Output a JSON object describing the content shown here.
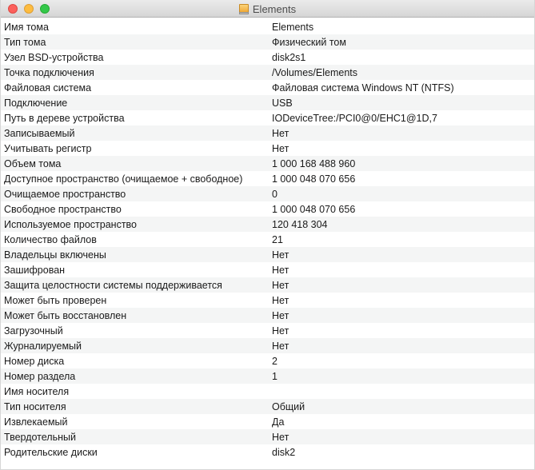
{
  "window": {
    "title": "Elements",
    "title_icon": "external-drive-icon"
  },
  "properties": [
    {
      "key": "Имя тома",
      "value": "Elements"
    },
    {
      "key": "Тип тома",
      "value": "Физический том"
    },
    {
      "key": "Узел BSD-устройства",
      "value": "disk2s1"
    },
    {
      "key": "Точка подключения",
      "value": "/Volumes/Elements"
    },
    {
      "key": "Файловая система",
      "value": "Файловая система Windows NT (NTFS)"
    },
    {
      "key": "Подключение",
      "value": "USB"
    },
    {
      "key": "Путь в дереве устройства",
      "value": "IODeviceTree:/PCI0@0/EHC1@1D,7"
    },
    {
      "key": "Записываемый",
      "value": "Нет"
    },
    {
      "key": "Учитывать регистр",
      "value": "Нет"
    },
    {
      "key": "Объем тома",
      "value": "1 000 168 488 960"
    },
    {
      "key": "Доступное пространство (очищаемое + свободное)",
      "value": "1 000 048 070 656"
    },
    {
      "key": "Очищаемое пространство",
      "value": "0"
    },
    {
      "key": "Свободное пространство",
      "value": "1 000 048 070 656"
    },
    {
      "key": "Используемое пространство",
      "value": "120 418 304"
    },
    {
      "key": "Количество файлов",
      "value": "21"
    },
    {
      "key": "Владельцы включены",
      "value": "Нет"
    },
    {
      "key": "Зашифрован",
      "value": "Нет"
    },
    {
      "key": "Защита целостности системы поддерживается",
      "value": "Нет"
    },
    {
      "key": "Может быть проверен",
      "value": "Нет"
    },
    {
      "key": "Может быть восстановлен",
      "value": "Нет"
    },
    {
      "key": "Загрузочный",
      "value": "Нет"
    },
    {
      "key": "Журналируемый",
      "value": "Нет"
    },
    {
      "key": "Номер диска",
      "value": "2"
    },
    {
      "key": "Номер раздела",
      "value": "1"
    },
    {
      "key": "Имя носителя",
      "value": ""
    },
    {
      "key": "Тип носителя",
      "value": "Общий"
    },
    {
      "key": "Извлекаемый",
      "value": "Да"
    },
    {
      "key": "Твердотельный",
      "value": "Нет"
    },
    {
      "key": "Родительские диски",
      "value": "disk2"
    }
  ]
}
